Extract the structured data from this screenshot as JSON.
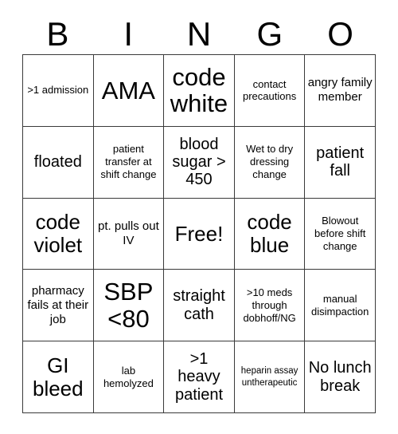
{
  "header": {
    "letters": [
      "B",
      "I",
      "N",
      "G",
      "O"
    ]
  },
  "grid": {
    "columns": 5,
    "rows": 5,
    "cells": [
      {
        "text": ">1 admission",
        "size": "t-xs"
      },
      {
        "text": "AMA",
        "size": "t-xl"
      },
      {
        "text": "code white",
        "size": "t-xl"
      },
      {
        "text": "contact precautions",
        "size": "t-xs"
      },
      {
        "text": "angry family member",
        "size": "t-sm"
      },
      {
        "text": "floated",
        "size": "t-md"
      },
      {
        "text": "patient transfer at shift change",
        "size": "t-xs"
      },
      {
        "text": "blood sugar > 450",
        "size": "t-md"
      },
      {
        "text": "Wet to dry dressing change",
        "size": "t-xs"
      },
      {
        "text": "patient fall",
        "size": "t-md"
      },
      {
        "text": "code violet",
        "size": "t-lg"
      },
      {
        "text": "pt. pulls out IV",
        "size": "t-sm"
      },
      {
        "text": "Free!",
        "size": "t-lg"
      },
      {
        "text": "code blue",
        "size": "t-lg"
      },
      {
        "text": "Blowout before shift change",
        "size": "t-xs"
      },
      {
        "text": "pharmacy fails at their job",
        "size": "t-sm"
      },
      {
        "text": "SBP <80",
        "size": "t-xl"
      },
      {
        "text": "straight cath",
        "size": "t-md"
      },
      {
        "text": ">10 meds through dobhoff/NG",
        "size": "t-xs"
      },
      {
        "text": "manual disimpaction",
        "size": "t-xs"
      },
      {
        "text": "GI bleed",
        "size": "t-lg"
      },
      {
        "text": "lab hemolyzed",
        "size": "t-xs"
      },
      {
        "text": ">1 heavy patient",
        "size": "t-md"
      },
      {
        "text": "heparin assay untherapeutic",
        "size": "t-xxs"
      },
      {
        "text": "No lunch break",
        "size": "t-md"
      }
    ]
  },
  "colors": {
    "background": "#ffffff",
    "text": "#000000",
    "border": "#3a3a3a"
  }
}
